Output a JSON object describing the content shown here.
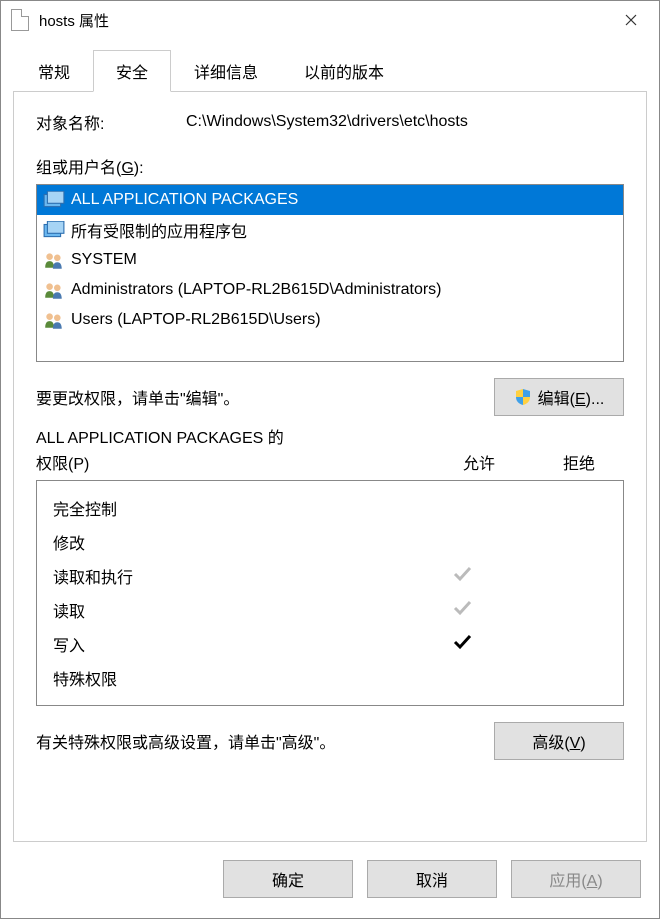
{
  "title": "hosts 属性",
  "tabs": [
    {
      "label": "常规",
      "active": false
    },
    {
      "label": "安全",
      "active": true
    },
    {
      "label": "详细信息",
      "active": false
    },
    {
      "label": "以前的版本",
      "active": false
    }
  ],
  "objectNameLabel": "对象名称:",
  "objectNameValue": "C:\\Windows\\System32\\drivers\\etc\\hosts",
  "groupsLabelPrefix": "组或用户名(",
  "groupsLabelHotkey": "G",
  "groupsLabelSuffix": "):",
  "groups": [
    {
      "name": "ALL APPLICATION PACKAGES",
      "icon": "package",
      "selected": true
    },
    {
      "name": "所有受限制的应用程序包",
      "icon": "package",
      "selected": false
    },
    {
      "name": "SYSTEM",
      "icon": "users",
      "selected": false
    },
    {
      "name": "Administrators (LAPTOP-RL2B615D\\Administrators)",
      "icon": "users",
      "selected": false
    },
    {
      "name": "Users (LAPTOP-RL2B615D\\Users)",
      "icon": "users",
      "selected": false
    }
  ],
  "editHint": "要更改权限，请单击\"编辑\"。",
  "editButtonPrefix": "编辑(",
  "editButtonHotkey": "E",
  "editButtonSuffix": ")...",
  "permissionsForLine1": "ALL APPLICATION PACKAGES 的",
  "permissionsForLine2Prefix": "权限(",
  "permissionsForLine2Hotkey": "P",
  "permissionsForLine2Suffix": ")",
  "allowHeader": "允许",
  "denyHeader": "拒绝",
  "permissions": [
    {
      "name": "完全控制",
      "allow": "",
      "deny": ""
    },
    {
      "name": "修改",
      "allow": "",
      "deny": ""
    },
    {
      "name": "读取和执行",
      "allow": "gray",
      "deny": ""
    },
    {
      "name": "读取",
      "allow": "gray",
      "deny": ""
    },
    {
      "name": "写入",
      "allow": "black",
      "deny": ""
    },
    {
      "name": "特殊权限",
      "allow": "",
      "deny": ""
    }
  ],
  "advancedHint": "有关特殊权限或高级设置，请单击\"高级\"。",
  "advancedButtonPrefix": "高级(",
  "advancedButtonHotkey": "V",
  "advancedButtonSuffix": ")",
  "okButton": "确定",
  "cancelButton": "取消",
  "applyButtonPrefix": "应用(",
  "applyButtonHotkey": "A",
  "applyButtonSuffix": ")"
}
